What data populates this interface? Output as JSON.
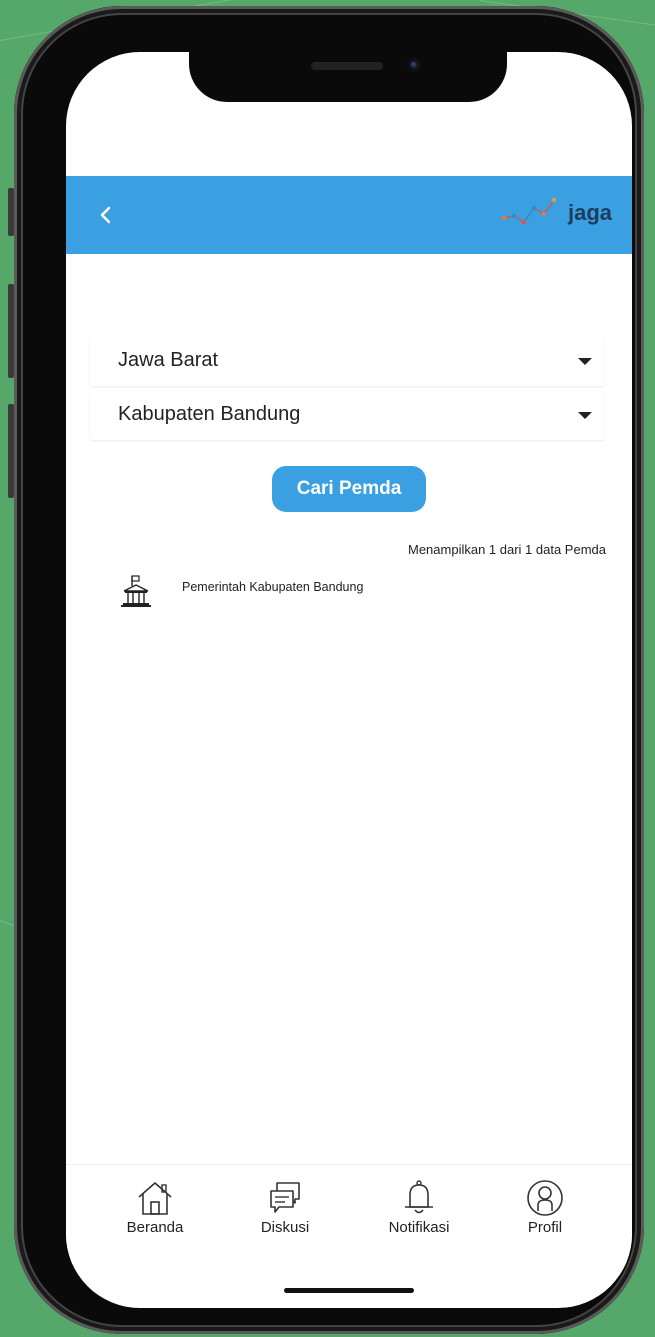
{
  "appbar": {
    "back_icon": "chevron-left-icon",
    "logo_text": "jaga"
  },
  "filters": {
    "province": "Jawa Barat",
    "regency": "Kabupaten Bandung"
  },
  "search_button_label": "Cari Pemda",
  "result_count_text": "Menampilkan 1 dari 1 data Pemda",
  "results": [
    {
      "name": "Pemerintah Kabupaten Bandung",
      "icon": "government-building-icon"
    }
  ],
  "bottom_nav": [
    {
      "label": "Beranda",
      "icon": "home-icon"
    },
    {
      "label": "Diskusi",
      "icon": "chat-icon"
    },
    {
      "label": "Notifikasi",
      "icon": "bell-icon"
    },
    {
      "label": "Profil",
      "icon": "user-icon"
    }
  ],
  "colors": {
    "accent": "#3aa0e2",
    "background": "#56a86a"
  }
}
